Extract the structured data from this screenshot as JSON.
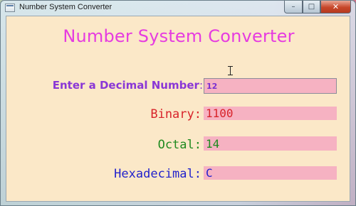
{
  "window": {
    "title": "Number System Converter",
    "controls": {
      "minimize": "–",
      "maximize": "□",
      "close": "✕"
    }
  },
  "form": {
    "heading": "Number System Converter",
    "decimal": {
      "label": "Enter a Decimal Number",
      "colon": ":",
      "value": "12"
    },
    "binary": {
      "label": "Binary:",
      "value": "1100"
    },
    "octal": {
      "label": "Octal:",
      "value": "14"
    },
    "hex": {
      "label": "Hexadecimal:",
      "value": "C"
    }
  },
  "colors": {
    "client_background": "#fbe8c8",
    "field_background": "#f6b2c2",
    "heading": "#e63ce0",
    "decimal": "#8a37d6",
    "binary": "#d8232a",
    "octal": "#1f8a1f",
    "hex": "#2222cc"
  },
  "icons": [
    "app-icon",
    "minimize-icon",
    "maximize-icon",
    "close-icon",
    "text-cursor-icon"
  ]
}
